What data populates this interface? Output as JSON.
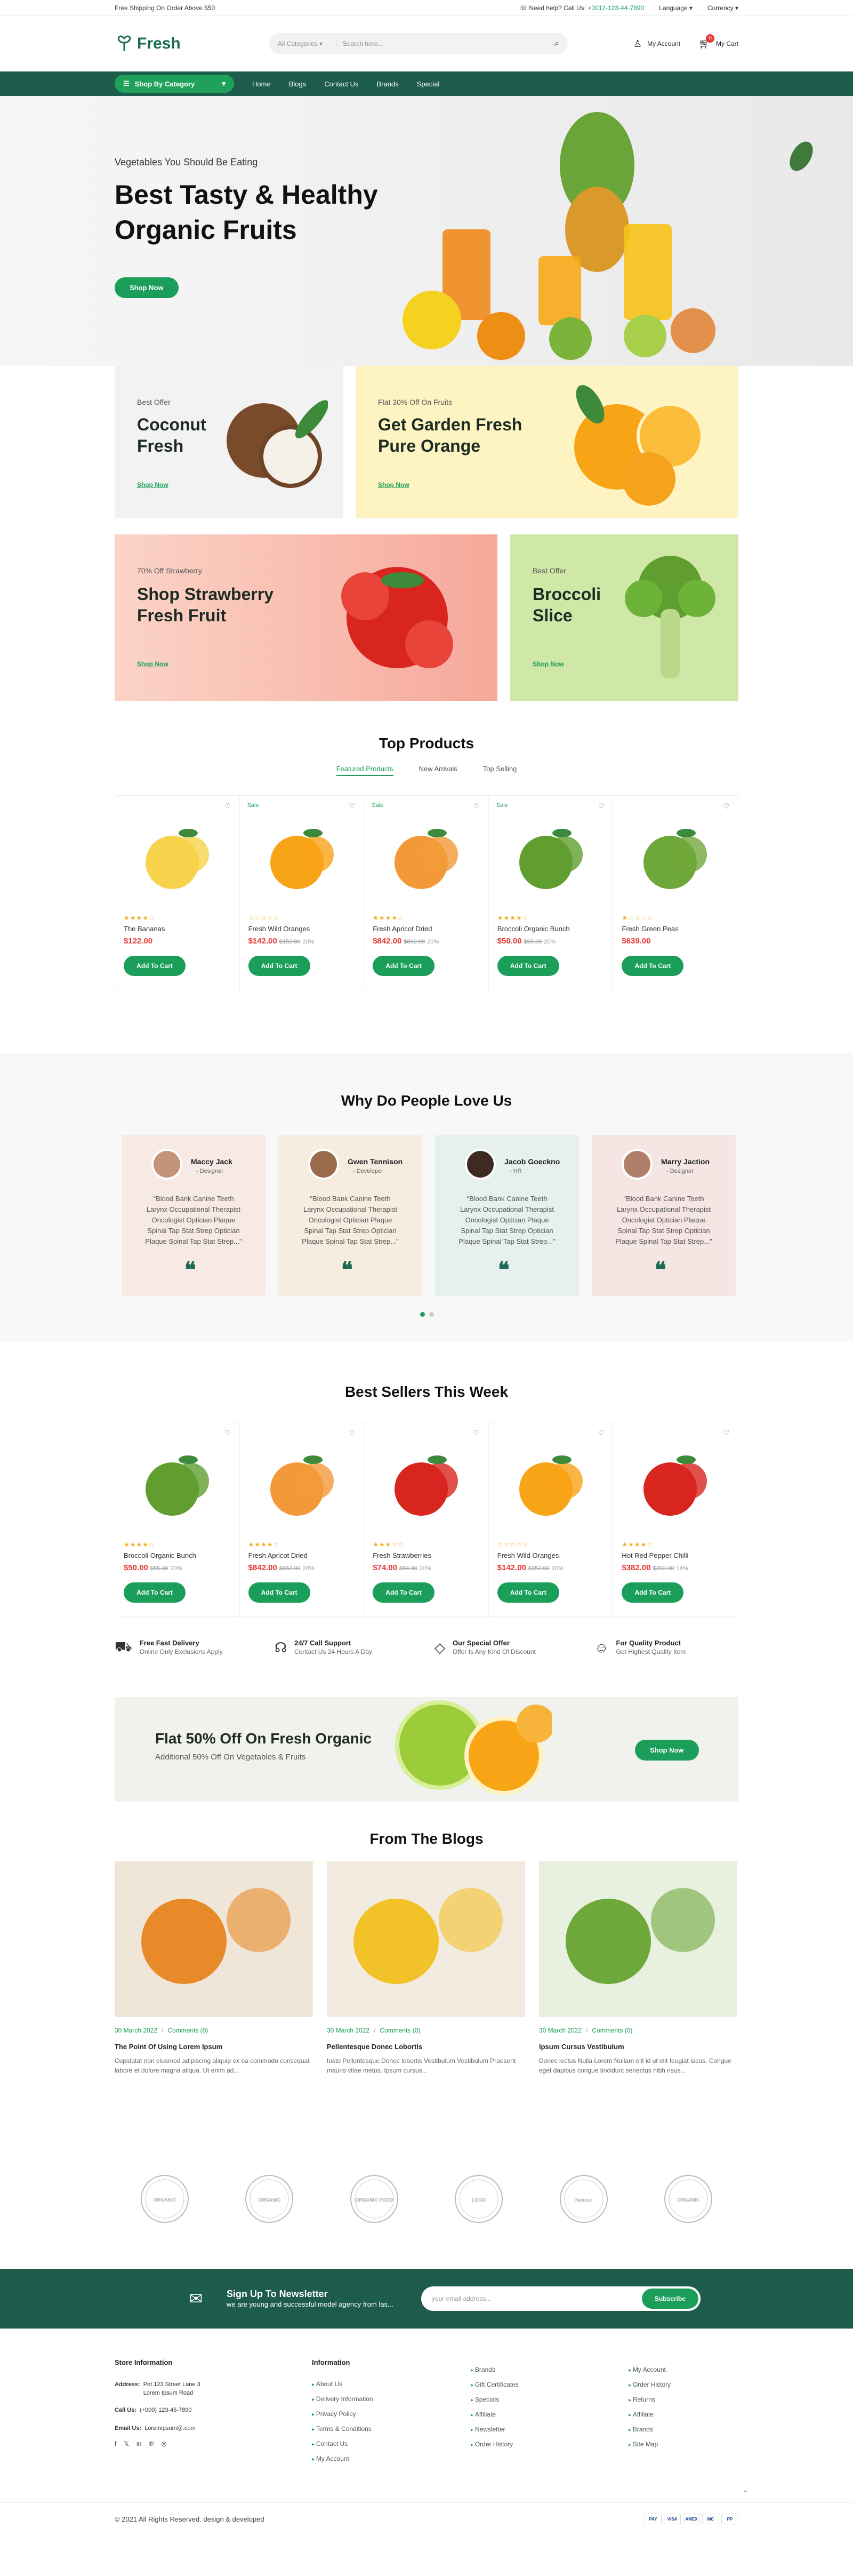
{
  "topbar": {
    "left": "Free Shipping On Order Above $50",
    "help": "Need help? Call Us:",
    "phone": "+0012-123-44-7890",
    "language": "Language",
    "currency": "Currency"
  },
  "header": {
    "logo": "Fresh",
    "search_category": "All Categories",
    "search_placeholder": "Search here...",
    "account": "My Account",
    "cart": "My Cart",
    "cart_count": "0"
  },
  "nav": {
    "category_btn": "Shop By Category",
    "links": [
      "Home",
      "Blogs",
      "Contact Us",
      "Brands",
      "Special"
    ]
  },
  "hero": {
    "subtitle": "Vegetables You Should Be Eating",
    "title": "Best Tasty & Healthy Organic Fruits",
    "button": "Shop Now"
  },
  "banners": [
    {
      "tag": "Best Offer",
      "title": "Coconut Fresh",
      "link": "Shop Now"
    },
    {
      "tag": "Flat 30% Off On Fruits",
      "title": "Get Garden Fresh Pure Orange",
      "link": "Shop Now"
    },
    {
      "tag": "70% Off Strawberry",
      "title": "Shop Strawberry Fresh Fruit",
      "link": "Shop Now"
    },
    {
      "tag": "Best Offer",
      "title": "Broccoli Slice",
      "link": "Shop Now"
    }
  ],
  "top_products": {
    "title": "Top Products",
    "tabs": [
      "Featured Products",
      "New Arrivals",
      "Top Selling"
    ],
    "items": [
      {
        "name": "The Bananas",
        "price": "$122.00",
        "old": "",
        "off": "",
        "sale": "",
        "rating": 4
      },
      {
        "name": "Fresh Wild Oranges",
        "price": "$142.00",
        "old": "$152.00",
        "off": "20%",
        "sale": "Sale",
        "rating": 0
      },
      {
        "name": "Fresh Apricot Dried",
        "price": "$842.00",
        "old": "$862.00",
        "off": "20%",
        "sale": "Sale",
        "rating": 4
      },
      {
        "name": "Broccoli Organic Bunch",
        "price": "$50.00",
        "old": "$55.00",
        "off": "20%",
        "sale": "Sale",
        "rating": 4
      },
      {
        "name": "Fresh Green Peas",
        "price": "$639.00",
        "old": "",
        "off": "",
        "sale": "",
        "rating": 1
      }
    ],
    "add_label": "Add To Cart"
  },
  "testimonials": {
    "title": "Why Do People Love Us",
    "items": [
      {
        "name": "Maccy Jack",
        "role": "- Designer",
        "text": "\"Blood Bank Canine Teeth Larynx Occupational Therapist Oncologist Optician Plaque Spinal Tap Stat Strep Optician Plaque Spinal Tap Stat Strep...\"",
        "bg": "#f7e9e4"
      },
      {
        "name": "Gwen Tennison",
        "role": "- Developer",
        "text": "\"Blood Bank Canine Teeth Larynx Occupational Therapist Oncologist Optician Plaque Spinal Tap Stat Strep Optician Plaque Spinal Tap Stat Strep...\"",
        "bg": "#f6ece0"
      },
      {
        "name": "Jacob Goeckno",
        "role": "- HR",
        "text": "\"Blood Bank Canine Teeth Larynx Occupational Therapist Oncologist Optician Plaque Spinal Tap Stat Strep Optician Plaque Spinal Tap Stat Strep...\"",
        "bg": "#e6f0ef"
      },
      {
        "name": "Marry Jaction",
        "role": "- Designer",
        "text": "\"Blood Bank Canine Teeth Larynx Occupational Therapist Oncologist Optician Plaque Spinal Tap Stat Strep Optician Plaque Spinal Tap Stat Strep...\"",
        "bg": "#f5e6e4"
      }
    ]
  },
  "best_sellers": {
    "title": "Best Sellers This Week",
    "items": [
      {
        "name": "Broccoli Organic Bunch",
        "price": "$50.00",
        "old": "$55.00",
        "off": "20%",
        "rating": 4
      },
      {
        "name": "Fresh Apricot Dried",
        "price": "$842.00",
        "old": "$862.00",
        "off": "20%",
        "rating": 4
      },
      {
        "name": "Fresh Strawberries",
        "price": "$74.00",
        "old": "$84.00",
        "off": "20%",
        "rating": 3
      },
      {
        "name": "Fresh Wild Oranges",
        "price": "$142.00",
        "old": "$152.00",
        "off": "20%",
        "rating": 0
      },
      {
        "name": "Hot Red Pepper Chilli",
        "price": "$382.00",
        "old": "$392.00",
        "off": "14%",
        "rating": 4
      }
    ]
  },
  "features": [
    {
      "title": "Free Fast Delivery",
      "sub": "Online Only Exclusions Apply"
    },
    {
      "title": "24/7 Call Support",
      "sub": "Contact Us 24 Hours A Day"
    },
    {
      "title": "Our Special Offer",
      "sub": "Offer Is Any Kind Of Discount"
    },
    {
      "title": "For Quality Product",
      "sub": "Get Highest Quality Item"
    }
  ],
  "promo": {
    "title": "Flat 50% Off On Fresh Organic",
    "sub": "Additional 50% Off On Vegetables & Fruits",
    "button": "Shop Now"
  },
  "blogs": {
    "title": "From The Blogs",
    "items": [
      {
        "date": "30 March 2022",
        "comments": "Comments (0)",
        "title": "The Point Of Using Lorem Ipsum",
        "text": "Cupidatat non eiusmod adipiscing aliquip ex ea commodo consequat labore et dolore magna aliqua. Ut enim ad..."
      },
      {
        "date": "30 March 2022",
        "comments": "Comments (0)",
        "title": "Pellentesque Donec Lobortis",
        "text": "Iusto Pellentesque Donec lobortis Vestibulum Vestibulum Praesent mauris vitae metus. Ipsum cursus..."
      },
      {
        "date": "30 March 2022",
        "comments": "Comments (0)",
        "title": "Ipsum Cursus Vestibulum",
        "text": "Donec lectus Nulla Lorem Nullam elit id ut elit feugiat lacus. Congue eget dapibus congue tincidunt senectus nibh risus..."
      }
    ]
  },
  "newsletter": {
    "title": "Sign Up To Newsletter",
    "sub": "we are young and successful model agency from las...",
    "placeholder": "your email address...",
    "button": "Subscribe"
  },
  "footer": {
    "store_title": "Store Information",
    "address_label": "Address:",
    "address": "Pot 123 Street Lane 3 Lorem Ipsum Road",
    "call_label": "Call Us:",
    "call": "(+000) 123-45-7890",
    "email_label": "Email Us:",
    "email": "Loremipsum@.com",
    "social": [
      "f",
      "𝕏",
      "in",
      "℗",
      "◎"
    ],
    "info_title": "Information",
    "info_links": [
      "About Us",
      "Delivery Information",
      "Privacy Policy",
      "Terms & Conditions",
      "Contact Us",
      "My Account"
    ],
    "col3": [
      "Brands",
      "Gift Certificates",
      "Specials",
      "Affiliate",
      "Newsletter",
      "Order History"
    ],
    "col4": [
      "My Account",
      "Order History",
      "Returns",
      "Affiliate",
      "Brands",
      "Site Map"
    ],
    "copyright": "© 2021 All Rights Reserved. design & developed",
    "payments": [
      "PAY",
      "VISA",
      "AMEX",
      "MC",
      "PP"
    ]
  },
  "brand_logos": [
    "ORGANIC",
    "ORGANIC",
    "ORGANIC FOOD",
    "LOGO",
    "Natural",
    "ORGANIC"
  ]
}
